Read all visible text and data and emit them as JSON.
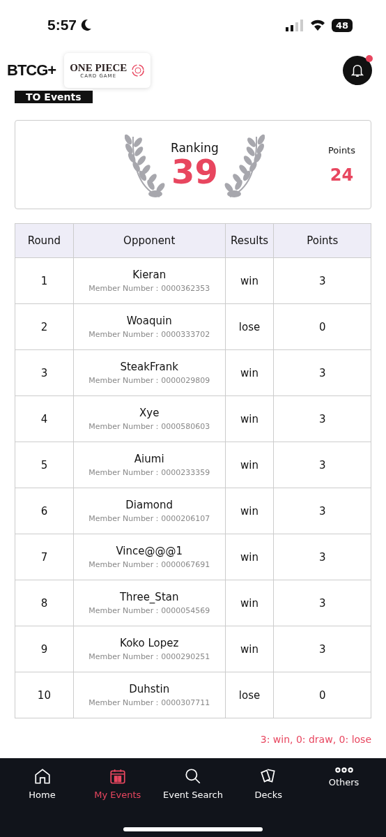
{
  "status_bar": {
    "time": "5:57",
    "battery": "48"
  },
  "header": {
    "app_logo": "BTCG+",
    "game_logo": {
      "title": "ONE PIECE",
      "subtitle": "CARD GAME"
    },
    "notification_dot": true
  },
  "section_tab": "TO Events",
  "summary": {
    "ranking_label": "Ranking",
    "ranking": "39",
    "points_label": "Points",
    "points": "24"
  },
  "table": {
    "columns": [
      "Round",
      "Opponent",
      "Results",
      "Points"
    ],
    "rows": [
      {
        "round": "1",
        "name": "Kieran",
        "member": "Member Number：0000362353",
        "result": "win",
        "points": "3"
      },
      {
        "round": "2",
        "name": "Woaquin",
        "member": "Member Number：0000333702",
        "result": "lose",
        "points": "0"
      },
      {
        "round": "3",
        "name": "SteakFrank",
        "member": "Member Number：0000029809",
        "result": "win",
        "points": "3"
      },
      {
        "round": "4",
        "name": "Xye",
        "member": "Member Number：0000580603",
        "result": "win",
        "points": "3"
      },
      {
        "round": "5",
        "name": "Aiumi",
        "member": "Member Number：0000233359",
        "result": "win",
        "points": "3"
      },
      {
        "round": "6",
        "name": "Diamond",
        "member": "Member Number：0000206107",
        "result": "win",
        "points": "3"
      },
      {
        "round": "7",
        "name": "Vince@@@1",
        "member": "Member Number：0000067691",
        "result": "win",
        "points": "3"
      },
      {
        "round": "8",
        "name": "Three_Stan",
        "member": "Member Number：0000054569",
        "result": "win",
        "points": "3"
      },
      {
        "round": "9",
        "name": "Koko Lopez",
        "member": "Member Number：0000290251",
        "result": "win",
        "points": "3"
      },
      {
        "round": "10",
        "name": "Duhstin",
        "member": "Member Number：0000307711",
        "result": "lose",
        "points": "0"
      }
    ]
  },
  "legend": "3: win, 0: draw, 0: lose",
  "nav": [
    {
      "kind": "home",
      "label": "Home",
      "selected": false
    },
    {
      "kind": "calendar",
      "label": "My Events",
      "selected": true
    },
    {
      "kind": "search",
      "label": "Event Search",
      "selected": false
    },
    {
      "kind": "cards",
      "label": "Decks",
      "selected": false
    },
    {
      "kind": "more",
      "label": "Others",
      "selected": false
    }
  ]
}
